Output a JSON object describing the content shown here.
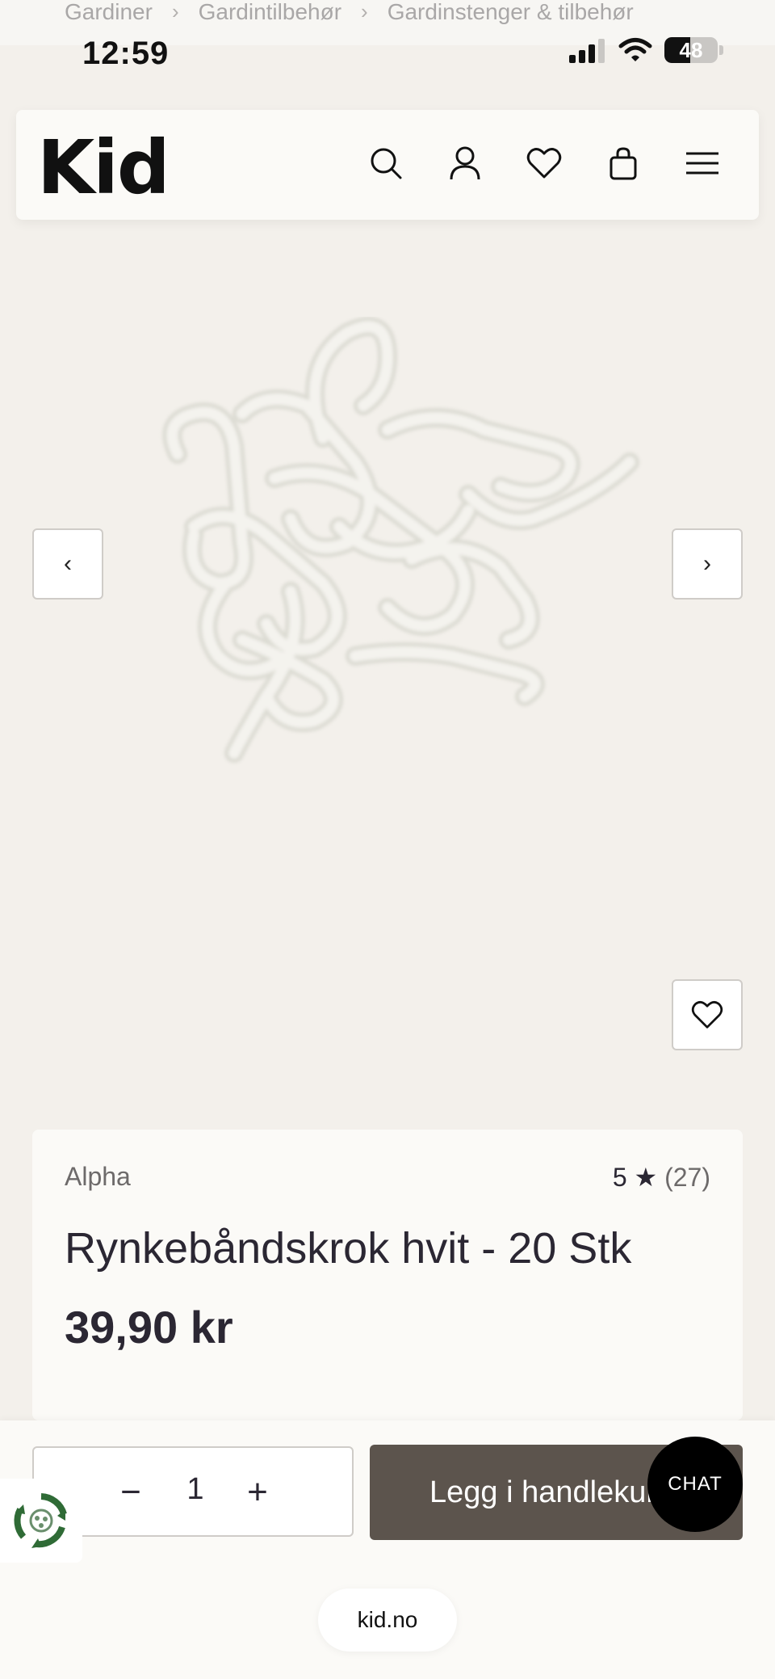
{
  "breadcrumb": {
    "items": [
      "Gardiner",
      "Gardintilbehør",
      "Gardinstenger & tilbehør"
    ],
    "separator": "›"
  },
  "status_bar": {
    "time": "12:59",
    "battery": "48",
    "battery_level": 0.48
  },
  "header": {
    "logo": "Kid",
    "icons": [
      "search-icon",
      "account-icon",
      "heart-icon",
      "bag-icon",
      "menu-icon"
    ]
  },
  "gallery": {
    "prev_label": "‹",
    "next_label": "›"
  },
  "product": {
    "brand": "Alpha",
    "rating": "5 ★",
    "rating_count": "(27)",
    "title": "Rynkebåndskrok hvit - 20 Stk",
    "price": "39,90 kr"
  },
  "cart": {
    "quantity": "1",
    "minus_label": "−",
    "plus_label": "+",
    "add_label": "Legg i handlekurv"
  },
  "chat": {
    "label": "CHAT"
  },
  "browser": {
    "url": "kid.no"
  },
  "colors": {
    "background": "#f3f0eb",
    "card": "#fbfaf7",
    "add_button": "#5c544d",
    "text": "#2b2733"
  }
}
